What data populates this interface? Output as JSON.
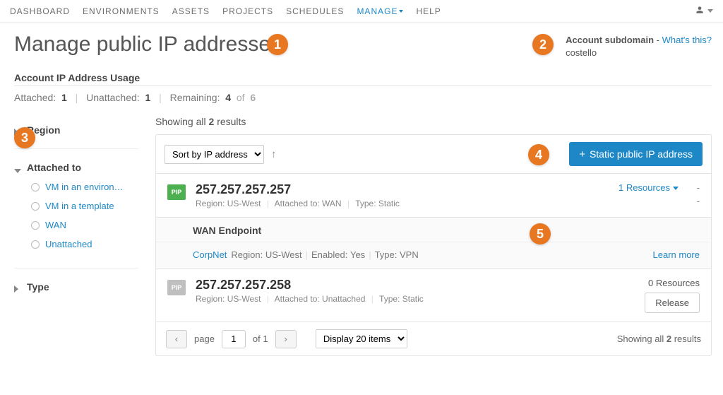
{
  "nav": {
    "items": [
      "DASHBOARD",
      "ENVIRONMENTS",
      "ASSETS",
      "PROJECTS",
      "SCHEDULES",
      "MANAGE",
      "HELP"
    ]
  },
  "page_title": "Manage public IP addresses",
  "subdomain": {
    "label": "Account subdomain",
    "link": "What's this?",
    "value": "costello"
  },
  "usage": {
    "section_label": "Account IP Address Usage",
    "attached_label": "Attached:",
    "attached": "1",
    "unattached_label": "Unattached:",
    "unattached": "1",
    "remaining_label": "Remaining:",
    "remaining": "4",
    "of_label": "of",
    "total": "6"
  },
  "facets": {
    "region_label": "Region",
    "attached_label": "Attached to",
    "attached_options": [
      "VM in an environ…",
      "VM in a template",
      "WAN",
      "Unattached"
    ],
    "type_label": "Type"
  },
  "results": {
    "showing_prefix": "Showing all",
    "count": "2",
    "showing_suffix": "results"
  },
  "toolbar": {
    "sort_label": "Sort by IP address",
    "add_button": "Static public IP address"
  },
  "ips": [
    {
      "badge": "PIP",
      "addr": "257.257.257.257",
      "region_label": "Region:",
      "region": "US-West",
      "attached_label": "Attached to:",
      "attached": "WAN",
      "type_label": "Type:",
      "type": "Static",
      "resources_text": "1 Resources"
    },
    {
      "badge": "PIP",
      "addr": "257.257.257.258",
      "region_label": "Region:",
      "region": "US-West",
      "attached_label": "Attached to:",
      "attached": "Unattached",
      "type_label": "Type:",
      "type": "Static",
      "resources_text": "0 Resources",
      "release_label": "Release"
    }
  ],
  "endpoint": {
    "header": "WAN Endpoint",
    "name": "CorpNet",
    "region_label": "Region:",
    "region": "US-West",
    "enabled_label": "Enabled:",
    "enabled": "Yes",
    "type_label": "Type:",
    "type": "VPN",
    "learn_more": "Learn more"
  },
  "pager": {
    "page_label": "page",
    "page": "1",
    "of_label": "of",
    "total_pages": "1",
    "display_label": "Display 20 items",
    "footer_prefix": "Showing all",
    "footer_count": "2",
    "footer_suffix": "results"
  },
  "callouts": [
    "1",
    "2",
    "3",
    "4",
    "5"
  ]
}
